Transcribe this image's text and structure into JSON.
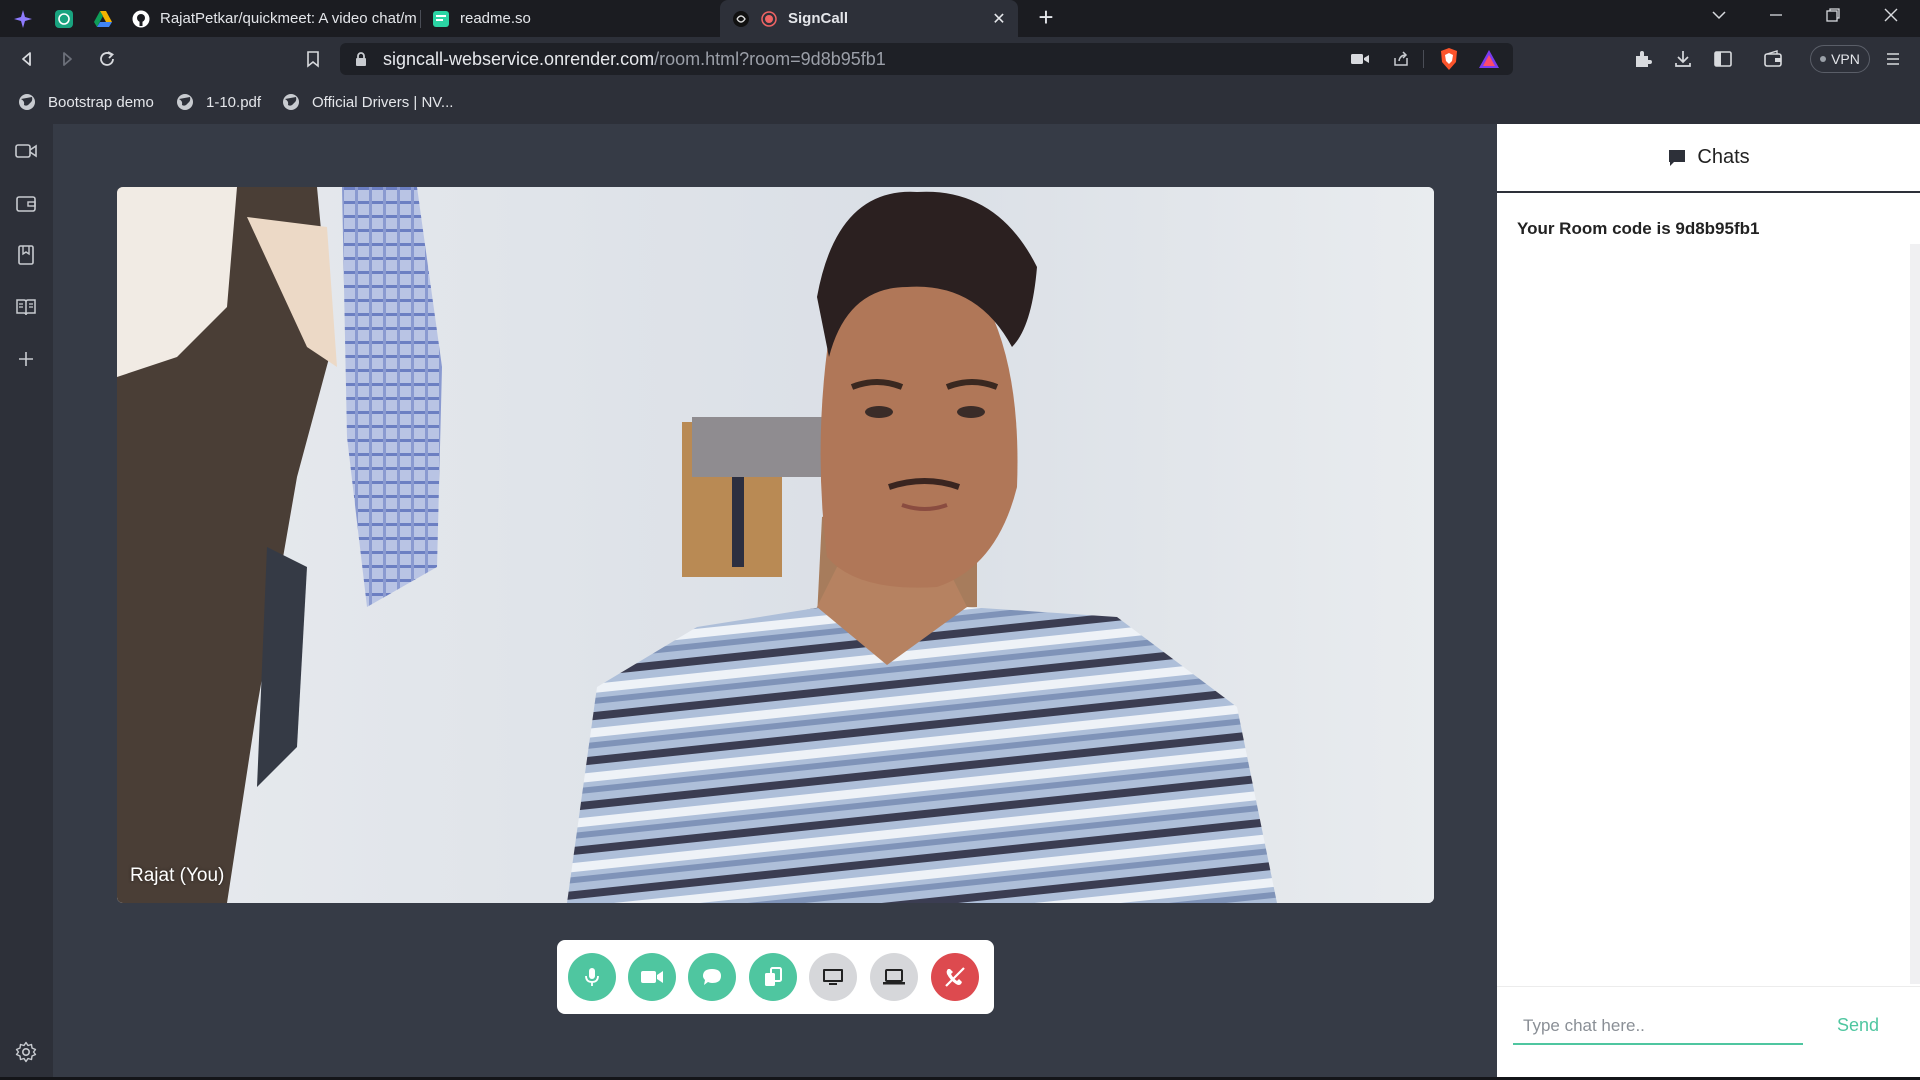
{
  "tabs": [
    {
      "label": "RajatPetkar/quickmeet: A video chat/m",
      "icon": "github-icon",
      "active": false
    },
    {
      "label": "readme.so",
      "icon": "readme-icon",
      "active": false
    },
    {
      "label": "SignCall",
      "icon": "signcall-icon",
      "active": true
    }
  ],
  "address": {
    "domain": "signcall-webservice.onrender.com",
    "path": "/room.html?room=9d8b95fb1"
  },
  "toolbar": {
    "vpn_label": "VPN"
  },
  "bookmarks": [
    {
      "label": "Bootstrap demo"
    },
    {
      "label": "1-10.pdf"
    },
    {
      "label": "Official Drivers | NV..."
    }
  ],
  "video": {
    "participant_label": "Rajat (You)"
  },
  "controls": [
    {
      "name": "mic-button",
      "icon": "microphone-icon",
      "color": "#4fc6a0"
    },
    {
      "name": "camera-button",
      "icon": "video-camera-icon",
      "color": "#4fc6a0"
    },
    {
      "name": "chat-button",
      "icon": "chat-bubble-icon",
      "color": "#4fc6a0"
    },
    {
      "name": "copy-code-button",
      "icon": "copy-icon",
      "color": "#4fc6a0"
    },
    {
      "name": "screen-share-button",
      "icon": "monitor-icon",
      "color": "#d6d7da"
    },
    {
      "name": "whiteboard-button",
      "icon": "laptop-icon",
      "color": "#d6d7da"
    },
    {
      "name": "end-call-button",
      "icon": "hangup-phone-icon",
      "color": "#dd4a4f"
    }
  ],
  "chat": {
    "title": "Chats",
    "room_message": "Your Room code is 9d8b95fb1",
    "input_placeholder": "Type chat here..",
    "send_label": "Send"
  },
  "colors": {
    "accent": "#4fc6a0",
    "danger": "#dd4a4f",
    "main_bg": "#363b46",
    "browser_chrome": "#2d3039"
  }
}
